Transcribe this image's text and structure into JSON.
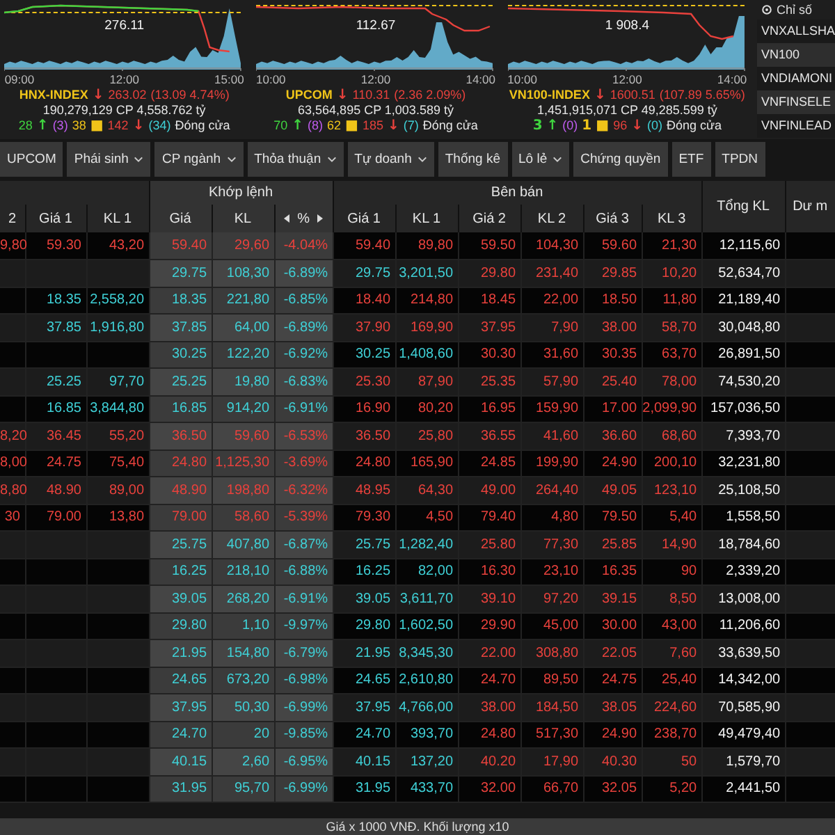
{
  "indices": [
    {
      "chart_value": "276.11",
      "times": [
        "09:00",
        "12:00",
        "15:00"
      ],
      "headline": [
        {
          "text": "HNX-INDEX",
          "color": "#f0c419"
        },
        {
          "text": "↓",
          "color": "#e8413c"
        },
        {
          "text": "263.02",
          "color": "#e8413c"
        },
        {
          "text": "(13.09  4.74%)",
          "color": "#e8413c"
        }
      ],
      "summary": "190,279,129 CP 4,558.762 tỷ",
      "breadth": [
        {
          "text": "28",
          "color": "#3fd43f"
        },
        {
          "text": "↑",
          "color": "#3fd43f"
        },
        {
          "text": "(3)",
          "color": "#c05cf0"
        },
        {
          "text": "38",
          "color": "#f0c419"
        },
        {
          "text": "■",
          "color": "#f0c419"
        },
        {
          "text": "142",
          "color": "#e8413c"
        },
        {
          "text": "↓",
          "color": "#e8413c"
        },
        {
          "text": "(34)",
          "color": "#3fd0d6"
        },
        {
          "text": "Đóng cửa",
          "color": "#e6e6e6"
        }
      ]
    },
    {
      "chart_value": "112.67",
      "times": [
        "10:00",
        "12:00",
        "14:00"
      ],
      "headline": [
        {
          "text": "UPCOM",
          "color": "#f0c419"
        },
        {
          "text": "↓",
          "color": "#e8413c"
        },
        {
          "text": "110.31",
          "color": "#e8413c"
        },
        {
          "text": "(2.36  2.09%)",
          "color": "#e8413c"
        }
      ],
      "summary": "63,564,895 CP 1,003.589 tỷ",
      "breadth": [
        {
          "text": "70",
          "color": "#3fd43f"
        },
        {
          "text": "↑",
          "color": "#3fd43f"
        },
        {
          "text": "(8)",
          "color": "#c05cf0"
        },
        {
          "text": "62",
          "color": "#f0c419"
        },
        {
          "text": "■",
          "color": "#f0c419"
        },
        {
          "text": "185",
          "color": "#e8413c"
        },
        {
          "text": "↓",
          "color": "#e8413c"
        },
        {
          "text": "(7)",
          "color": "#3fd0d6"
        },
        {
          "text": "Đóng cửa",
          "color": "#e6e6e6"
        }
      ]
    },
    {
      "chart_value": "1 908.4",
      "times": [
        "10:00",
        "12:00",
        "14:00"
      ],
      "headline": [
        {
          "text": "VN100-INDEX",
          "color": "#f0c419"
        },
        {
          "text": "↓",
          "color": "#e8413c"
        },
        {
          "text": "1600.51",
          "color": "#e8413c"
        },
        {
          "text": "(107.89  5.65%)",
          "color": "#e8413c"
        }
      ],
      "summary": "1,451,915,071 CP 49,285.599 tỷ",
      "breadth": [
        {
          "text": "3",
          "color": "#3fd43f"
        },
        {
          "text": "↑",
          "color": "#3fd43f"
        },
        {
          "text": "(0)",
          "color": "#c05cf0"
        },
        {
          "text": "1",
          "color": "#f0c419"
        },
        {
          "text": "■",
          "color": "#f0c419"
        },
        {
          "text": "96",
          "color": "#e8413c"
        },
        {
          "text": "↓",
          "color": "#e8413c"
        },
        {
          "text": "(0)",
          "color": "#3fd0d6"
        },
        {
          "text": "Đóng cửa",
          "color": "#e6e6e6"
        }
      ]
    }
  ],
  "index_list": {
    "title": "Chỉ số",
    "items": [
      "VNXALLSHA",
      "VN100",
      "VNDIAMONI",
      "VNFINSELE",
      "VNFINLEAD"
    ]
  },
  "tabs": [
    {
      "label": "UPCOM",
      "dropdown": false
    },
    {
      "label": "Phái sinh",
      "dropdown": true
    },
    {
      "label": "CP ngành",
      "dropdown": true
    },
    {
      "label": "Thỏa thuận",
      "dropdown": true
    },
    {
      "label": "Tự doanh",
      "dropdown": true
    },
    {
      "label": "Thống kê",
      "dropdown": false
    },
    {
      "label": "Lô lẻ",
      "dropdown": true
    },
    {
      "label": "Chứng quyền",
      "dropdown": false
    },
    {
      "label": "ETF",
      "dropdown": false
    },
    {
      "label": "TPDN",
      "dropdown": false
    }
  ],
  "table": {
    "groups": {
      "match": "Khớp lệnh",
      "sell": "Bên bán"
    },
    "buy_columns": [
      "2",
      "Giá 1",
      "KL 1"
    ],
    "match_columns": [
      "Giá",
      "KL",
      "%"
    ],
    "sell_columns": [
      "Giá 1",
      "KL 1",
      "Giá 2",
      "KL 2",
      "Giá 3",
      "KL 3"
    ],
    "total_column": "Tổng KL",
    "last_column": "Dư m",
    "rows": [
      {
        "buy": [
          {
            "text": "9,80",
            "floor": false
          },
          {
            "text": "59.30",
            "floor": false
          },
          {
            "text": "43,20",
            "floor": false
          }
        ],
        "match": {
          "price": "59.40",
          "volume": "29,60",
          "change": "-4.04%",
          "floor": false
        },
        "sell": [
          {
            "price": "59.40",
            "volume": "89,80",
            "floor": false
          },
          {
            "price": "59.50",
            "volume": "104,30",
            "floor": false
          },
          {
            "price": "59.60",
            "volume": "21,30",
            "floor": false
          }
        ],
        "total": "12,115,60"
      },
      {
        "buy": [],
        "match": {
          "price": "29.75",
          "volume": "108,30",
          "change": "-6.89%",
          "floor": true
        },
        "sell": [
          {
            "price": "29.75",
            "volume": "3,201,50",
            "floor": true
          },
          {
            "price": "29.80",
            "volume": "231,40",
            "floor": false
          },
          {
            "price": "29.85",
            "volume": "10,20",
            "floor": false
          }
        ],
        "total": "52,634,70"
      },
      {
        "buy": [
          {
            "text": "18.35",
            "floor": true
          },
          {
            "text": "2,558,20",
            "floor": true
          }
        ],
        "match": {
          "price": "18.35",
          "volume": "221,80",
          "change": "-6.85%",
          "floor": true
        },
        "sell": [
          {
            "price": "18.40",
            "volume": "214,80",
            "floor": false
          },
          {
            "price": "18.45",
            "volume": "22,00",
            "floor": false
          },
          {
            "price": "18.50",
            "volume": "11,80",
            "floor": false
          }
        ],
        "total": "21,189,40"
      },
      {
        "buy": [
          {
            "text": "37.85",
            "floor": true
          },
          {
            "text": "1,916,80",
            "floor": true
          }
        ],
        "match": {
          "price": "37.85",
          "volume": "64,00",
          "change": "-6.89%",
          "floor": true
        },
        "sell": [
          {
            "price": "37.90",
            "volume": "169,90",
            "floor": false
          },
          {
            "price": "37.95",
            "volume": "7,90",
            "floor": false
          },
          {
            "price": "38.00",
            "volume": "58,70",
            "floor": false
          }
        ],
        "total": "30,048,80"
      },
      {
        "buy": [],
        "match": {
          "price": "30.25",
          "volume": "122,20",
          "change": "-6.92%",
          "floor": true
        },
        "sell": [
          {
            "price": "30.25",
            "volume": "1,408,60",
            "floor": true
          },
          {
            "price": "30.30",
            "volume": "31,60",
            "floor": false
          },
          {
            "price": "30.35",
            "volume": "63,70",
            "floor": false
          }
        ],
        "total": "26,891,50"
      },
      {
        "buy": [
          {
            "text": "25.25",
            "floor": true
          },
          {
            "text": "97,70",
            "floor": true
          }
        ],
        "match": {
          "price": "25.25",
          "volume": "19,80",
          "change": "-6.83%",
          "floor": true
        },
        "sell": [
          {
            "price": "25.30",
            "volume": "87,90",
            "floor": false
          },
          {
            "price": "25.35",
            "volume": "57,90",
            "floor": false
          },
          {
            "price": "25.40",
            "volume": "78,00",
            "floor": false
          }
        ],
        "total": "74,530,20"
      },
      {
        "buy": [
          {
            "text": "16.85",
            "floor": true
          },
          {
            "text": "3,844,80",
            "floor": true
          }
        ],
        "match": {
          "price": "16.85",
          "volume": "914,20",
          "change": "-6.91%",
          "floor": true
        },
        "sell": [
          {
            "price": "16.90",
            "volume": "80,20",
            "floor": false
          },
          {
            "price": "16.95",
            "volume": "159,90",
            "floor": false
          },
          {
            "price": "17.00",
            "volume": "2,099,90",
            "floor": false
          }
        ],
        "total": "157,036,50"
      },
      {
        "buy": [
          {
            "text": "8,20",
            "floor": false
          },
          {
            "text": "36.45",
            "floor": false
          },
          {
            "text": "55,20",
            "floor": false
          }
        ],
        "match": {
          "price": "36.50",
          "volume": "59,60",
          "change": "-6.53%",
          "floor": false
        },
        "sell": [
          {
            "price": "36.50",
            "volume": "25,80",
            "floor": false
          },
          {
            "price": "36.55",
            "volume": "41,60",
            "floor": false
          },
          {
            "price": "36.60",
            "volume": "68,60",
            "floor": false
          }
        ],
        "total": "7,393,70"
      },
      {
        "buy": [
          {
            "text": "8,00",
            "floor": false
          },
          {
            "text": "24.75",
            "floor": false
          },
          {
            "text": "75,40",
            "floor": false
          }
        ],
        "match": {
          "price": "24.80",
          "volume": "1,125,30",
          "change": "-3.69%",
          "floor": false
        },
        "sell": [
          {
            "price": "24.80",
            "volume": "165,90",
            "floor": false
          },
          {
            "price": "24.85",
            "volume": "199,90",
            "floor": false
          },
          {
            "price": "24.90",
            "volume": "200,10",
            "floor": false
          }
        ],
        "total": "32,231,80"
      },
      {
        "buy": [
          {
            "text": "8,80",
            "floor": false
          },
          {
            "text": "48.90",
            "floor": false
          },
          {
            "text": "89,00",
            "floor": false
          }
        ],
        "match": {
          "price": "48.90",
          "volume": "198,80",
          "change": "-6.32%",
          "floor": false
        },
        "sell": [
          {
            "price": "48.95",
            "volume": "64,30",
            "floor": false
          },
          {
            "price": "49.00",
            "volume": "264,40",
            "floor": false
          },
          {
            "price": "49.05",
            "volume": "123,10",
            "floor": false
          }
        ],
        "total": "25,108,50"
      },
      {
        "buy": [
          {
            "text": "30",
            "floor": false
          },
          {
            "text": "79.00",
            "floor": false
          },
          {
            "text": "13,80",
            "floor": false
          }
        ],
        "match": {
          "price": "79.00",
          "volume": "58,60",
          "change": "-5.39%",
          "floor": false
        },
        "sell": [
          {
            "price": "79.30",
            "volume": "4,50",
            "floor": false
          },
          {
            "price": "79.40",
            "volume": "4,80",
            "floor": false
          },
          {
            "price": "79.50",
            "volume": "5,40",
            "floor": false
          }
        ],
        "total": "1,558,50"
      },
      {
        "buy": [],
        "match": {
          "price": "25.75",
          "volume": "407,80",
          "change": "-6.87%",
          "floor": true
        },
        "sell": [
          {
            "price": "25.75",
            "volume": "1,282,40",
            "floor": true
          },
          {
            "price": "25.80",
            "volume": "77,30",
            "floor": false
          },
          {
            "price": "25.85",
            "volume": "14,90",
            "floor": false
          }
        ],
        "total": "18,784,60"
      },
      {
        "buy": [],
        "match": {
          "price": "16.25",
          "volume": "218,10",
          "change": "-6.88%",
          "floor": true
        },
        "sell": [
          {
            "price": "16.25",
            "volume": "82,00",
            "floor": true
          },
          {
            "price": "16.30",
            "volume": "23,10",
            "floor": false
          },
          {
            "price": "16.35",
            "volume": "90",
            "floor": false
          }
        ],
        "total": "2,339,20"
      },
      {
        "buy": [],
        "match": {
          "price": "39.05",
          "volume": "268,20",
          "change": "-6.91%",
          "floor": true
        },
        "sell": [
          {
            "price": "39.05",
            "volume": "3,611,70",
            "floor": true
          },
          {
            "price": "39.10",
            "volume": "97,20",
            "floor": false
          },
          {
            "price": "39.15",
            "volume": "8,50",
            "floor": false
          }
        ],
        "total": "13,008,00"
      },
      {
        "buy": [],
        "match": {
          "price": "29.80",
          "volume": "1,10",
          "change": "-9.97%",
          "floor": true
        },
        "sell": [
          {
            "price": "29.80",
            "volume": "1,602,50",
            "floor": true
          },
          {
            "price": "29.90",
            "volume": "45,00",
            "floor": false
          },
          {
            "price": "30.00",
            "volume": "43,00",
            "floor": false
          }
        ],
        "total": "11,206,60"
      },
      {
        "buy": [],
        "match": {
          "price": "21.95",
          "volume": "154,80",
          "change": "-6.79%",
          "floor": true
        },
        "sell": [
          {
            "price": "21.95",
            "volume": "8,345,30",
            "floor": true
          },
          {
            "price": "22.00",
            "volume": "308,80",
            "floor": false
          },
          {
            "price": "22.05",
            "volume": "7,60",
            "floor": false
          }
        ],
        "total": "33,639,50"
      },
      {
        "buy": [],
        "match": {
          "price": "24.65",
          "volume": "673,20",
          "change": "-6.98%",
          "floor": true
        },
        "sell": [
          {
            "price": "24.65",
            "volume": "2,610,80",
            "floor": true
          },
          {
            "price": "24.70",
            "volume": "89,50",
            "floor": false
          },
          {
            "price": "24.75",
            "volume": "25,40",
            "floor": false
          }
        ],
        "total": "14,342,00"
      },
      {
        "buy": [],
        "match": {
          "price": "37.95",
          "volume": "50,30",
          "change": "-6.99%",
          "floor": true
        },
        "sell": [
          {
            "price": "37.95",
            "volume": "4,766,00",
            "floor": true
          },
          {
            "price": "38.00",
            "volume": "184,50",
            "floor": false
          },
          {
            "price": "38.05",
            "volume": "224,60",
            "floor": false
          }
        ],
        "total": "70,585,90"
      },
      {
        "buy": [],
        "match": {
          "price": "24.70",
          "volume": "20",
          "change": "-9.85%",
          "floor": true
        },
        "sell": [
          {
            "price": "24.70",
            "volume": "393,70",
            "floor": true
          },
          {
            "price": "24.80",
            "volume": "517,30",
            "floor": false
          },
          {
            "price": "24.90",
            "volume": "238,70",
            "floor": false
          }
        ],
        "total": "49,479,40"
      },
      {
        "buy": [],
        "match": {
          "price": "40.15",
          "volume": "2,60",
          "change": "-6.95%",
          "floor": true
        },
        "sell": [
          {
            "price": "40.15",
            "volume": "137,20",
            "floor": true
          },
          {
            "price": "40.20",
            "volume": "17,90",
            "floor": false
          },
          {
            "price": "40.30",
            "volume": "50",
            "floor": false
          }
        ],
        "total": "1,579,70"
      },
      {
        "buy": [],
        "match": {
          "price": "31.95",
          "volume": "95,70",
          "change": "-6.99%",
          "floor": true
        },
        "sell": [
          {
            "price": "31.95",
            "volume": "433,70",
            "floor": true
          },
          {
            "price": "32.00",
            "volume": "66,70",
            "floor": false
          },
          {
            "price": "32.05",
            "volume": "5,20",
            "floor": false
          }
        ],
        "total": "2,441,50"
      }
    ]
  },
  "footer": "Giá x 1000 VNĐ. Khối lượng x10"
}
